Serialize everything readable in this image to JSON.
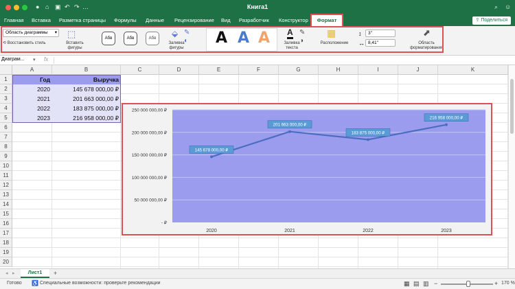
{
  "app": {
    "title": "Книга1",
    "accent_color": "#1e7145"
  },
  "menubar": {
    "tabs": [
      "Главная",
      "Вставка",
      "Разметка страницы",
      "Формулы",
      "Данные",
      "Рецензирование",
      "Вид",
      "Разработчик",
      "Конструктор",
      "Формат"
    ],
    "active_tab": "Формат",
    "share_label": "Поделиться"
  },
  "ribbon": {
    "element_selector": "Область диаграммы",
    "restore_style": "Восстановить стиль",
    "insert_shapes": "Вставить фигуры",
    "shape_style_sample": "Абв",
    "shape_fill": "Заливка фигуры",
    "text_fill": "Заливка текста",
    "arrange": "Расположение",
    "height_value": "3\"",
    "width_value": "8,41\"",
    "format_pane": "Область форматирования",
    "wordart_letter": "A"
  },
  "formula_bar": {
    "name_box": "Диаграм...",
    "fx": "fx"
  },
  "sheet": {
    "columns": [
      "A",
      "B",
      "C",
      "D",
      "E",
      "F",
      "G",
      "H",
      "I",
      "J",
      "K"
    ],
    "rows": [
      "1",
      "2",
      "3",
      "4",
      "5",
      "6",
      "7",
      "8",
      "9",
      "10",
      "11",
      "12",
      "13",
      "14",
      "15",
      "16",
      "17",
      "18",
      "19",
      "20"
    ],
    "header_cells": [
      "Год",
      "Выручка"
    ],
    "data_rows": [
      [
        "2020",
        "145 678 000,00 ₽"
      ],
      [
        "2021",
        "201 663 000,00 ₽"
      ],
      [
        "2022",
        "183 875 000,00 ₽"
      ],
      [
        "2023",
        "216 958 000,00 ₽"
      ]
    ]
  },
  "chart_data": {
    "type": "line",
    "categories": [
      "2020",
      "2021",
      "2022",
      "2023"
    ],
    "series": [
      {
        "values": [
          145678000,
          201663000,
          183875000,
          216958000
        ]
      }
    ],
    "data_labels": [
      "145 678 000,00 ₽",
      "201 663 000,00 ₽",
      "183 875 000,00 ₽",
      "216 958 000,00 ₽"
    ],
    "y_ticks": [
      "250 000 000,00 ₽",
      "200 000 000,00 ₽",
      "150 000 000,00 ₽",
      "100 000 000,00 ₽",
      "50 000 000,00 ₽",
      "-   ₽"
    ],
    "ylim": [
      0,
      250000000
    ],
    "grid": true,
    "plot_color": "#9c9cef",
    "line_color": "#4a6dc0",
    "label_bg": "#5b9bd5"
  },
  "sheet_tabs": {
    "active": "Лист1",
    "add_label": "+"
  },
  "status": {
    "ready": "Готово",
    "accessibility": "Специальные возможности: проверьте рекомендации",
    "zoom": "170 %"
  }
}
